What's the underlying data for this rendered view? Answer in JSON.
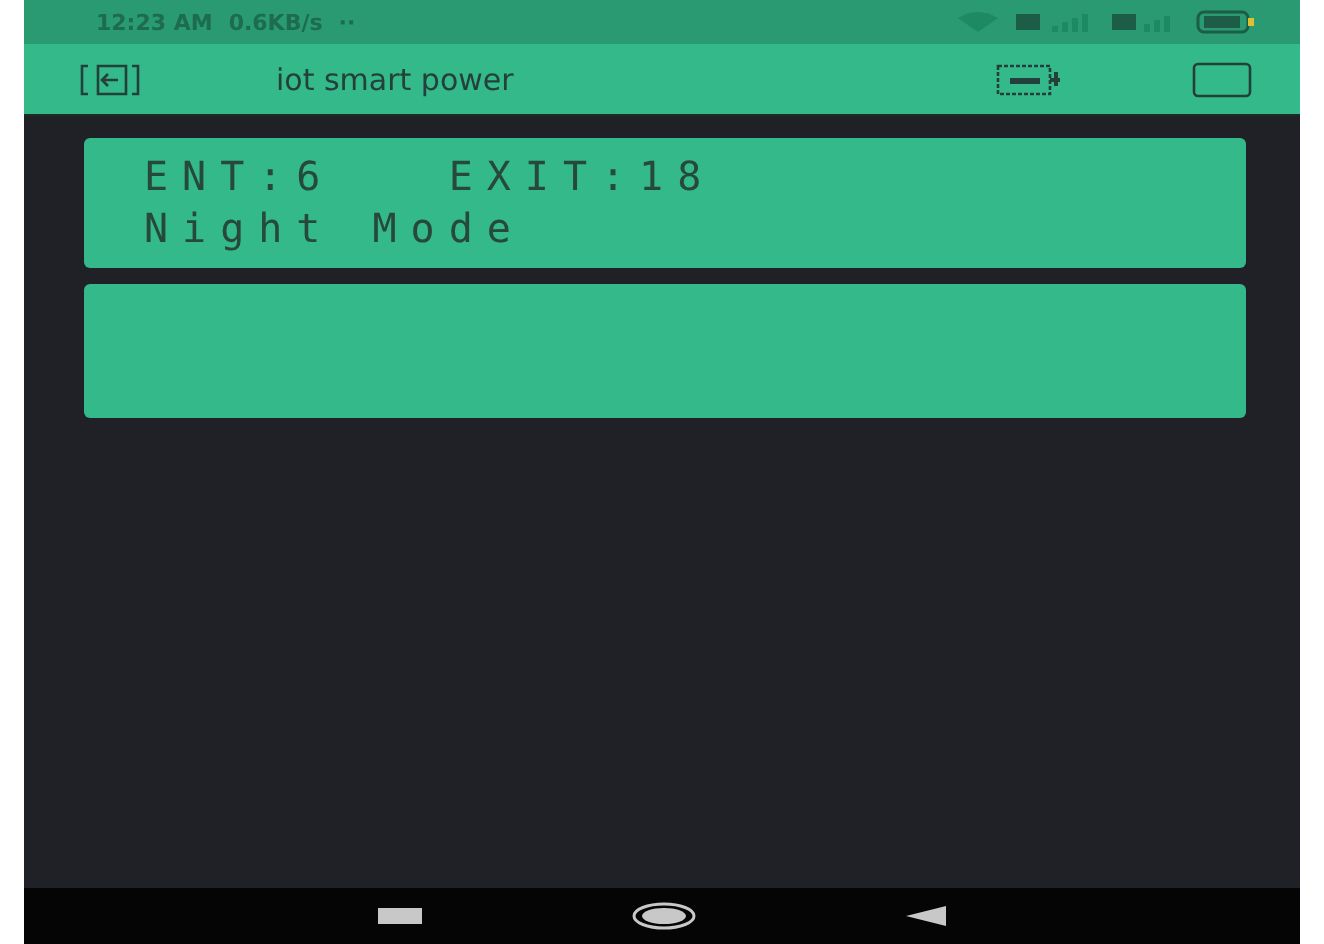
{
  "status_bar": {
    "time": "12:23 AM",
    "speed": "0.6KB/s",
    "dots": "··"
  },
  "app_bar": {
    "title": "iot smart power"
  },
  "panels": [
    {
      "kind": "lcd",
      "lines": [
        "ENT:6   EXIT:18",
        "Night Mode"
      ]
    },
    {
      "kind": "blank"
    }
  ]
}
